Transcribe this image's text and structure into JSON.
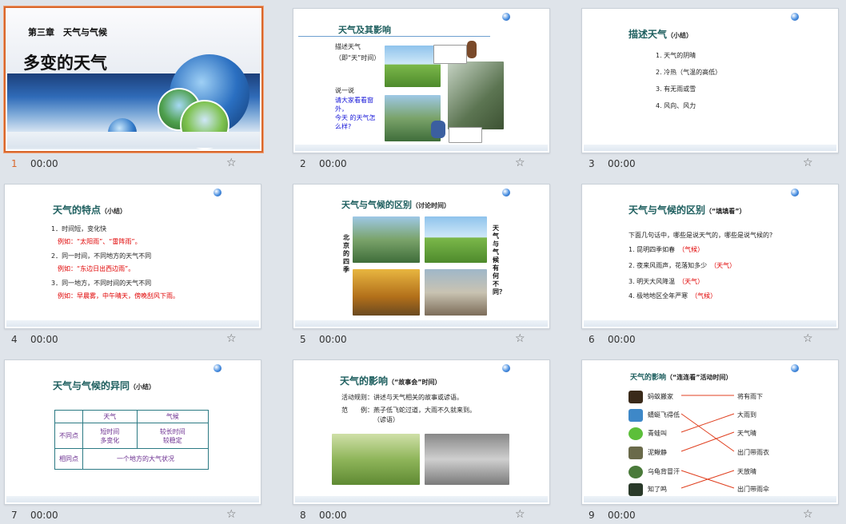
{
  "slides": [
    {
      "number": "1",
      "time": "00:00",
      "chapter": "第三章　天气与气候",
      "title": "多变的天气"
    },
    {
      "number": "2",
      "time": "00:00",
      "title": "天气及其影响",
      "left_label1": "描述天气",
      "left_label2": "（即“天”时间）",
      "say_title": "说一说",
      "say_l1": "请大家看看窗",
      "say_l2": "外，",
      "say_l3": "今天 的天气怎",
      "say_l4": "么样?"
    },
    {
      "number": "3",
      "time": "00:00",
      "title": "描述天气",
      "title_sub": "（小结）",
      "items": [
        "1. 天气的阴晴",
        "2. 冷热（气温的高低）",
        "3. 有无雨或雪",
        "4. 风向、风力"
      ]
    },
    {
      "number": "4",
      "time": "00:00",
      "title": "天气的特点",
      "title_sub": "（小结）",
      "l1": "1．时间短，变化快",
      "l1e": "例如：“太阳雨”、“雷阵雨”。",
      "l2": "2．同一时间，不同地方的天气不同",
      "l2e": "例如：“东边日出西边雨”。",
      "l3": "3．同一地方，不同时间的天气不同",
      "l3e": "例如：早晨雾，中午晴天，傍晚刮风下雨。"
    },
    {
      "number": "5",
      "time": "00:00",
      "title": "天气与气候的区别",
      "title_sub": "（讨论时间）",
      "left_vertical": "北京的四季",
      "right_vertical": "天气与气候有何不同？"
    },
    {
      "number": "6",
      "time": "00:00",
      "title": "天气与气候的区别",
      "title_sub": "（“填填看”）",
      "question": "下面几句话中，哪些是说天气的，哪些是说气候的?",
      "items": [
        {
          "text": "1. 昆明四季如春",
          "answer": "（气候）"
        },
        {
          "text": "2. 夜来风雨声，花落知多少",
          "answer": "（天气）"
        },
        {
          "text": "3. 明天大风降温",
          "answer": "（天气）"
        },
        {
          "text": "4. 极地地区全年严寒",
          "answer": "（气候）"
        }
      ]
    },
    {
      "number": "7",
      "time": "00:00",
      "title": "天气与气候的异同",
      "title_sub": "（小结）",
      "col1": "天气",
      "col2": "气候",
      "row1": "不同点",
      "r1c1a": "短时间",
      "r1c1b": "多变化",
      "r1c2a": "较长时间",
      "r1c2b": "较稳定",
      "row2": "相同点",
      "r2": "一个地方的大气状况"
    },
    {
      "number": "8",
      "time": "00:00",
      "title": "天气的影响",
      "title_sub": "（“故事会”时间）",
      "rule": "活动规则：讲述与天气相关的故事或谚语。",
      "example_label": "范　　例：",
      "example": "燕子低飞蛇过道，大雨不久就来到。",
      "example_note": "（谚语）"
    },
    {
      "number": "9",
      "time": "00:00",
      "title": "天气的影响",
      "title_sub": "（“连连看”活动时间）",
      "left": [
        "蚂蚁搬家",
        "蜻蜓飞得低",
        "青蛙叫",
        "泥鳅静",
        "乌龟背冒汗",
        "知了鸣"
      ],
      "right": [
        "将有雨下",
        "大雨到",
        "天气晴",
        "出门带雨衣",
        "天放晴",
        "出门带雨伞"
      ]
    }
  ],
  "colors": {
    "selected_border": "#d9672b",
    "title": "#1d5e5e",
    "red": "#e00000",
    "blue": "#1515d8"
  }
}
